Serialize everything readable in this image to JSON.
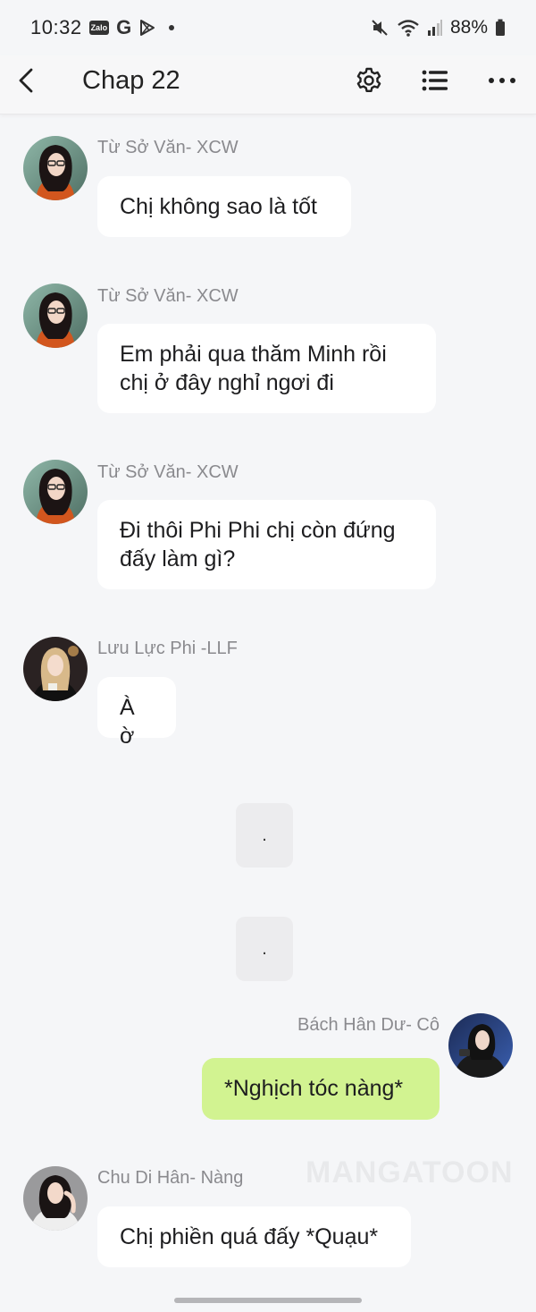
{
  "status_bar": {
    "time": "10:32",
    "notif_zalo": "Zalo",
    "notif_g": "G",
    "battery": "88%"
  },
  "app_bar": {
    "title": "Chap 22"
  },
  "messages": [
    {
      "sender": "Từ Sở Văn- XCW",
      "text": "Chị không sao là tốt",
      "side": "left"
    },
    {
      "sender": "Từ Sở Văn- XCW",
      "text_lines": [
        "Em phải qua thăm Minh rồi",
        "chị ở đây nghỉ ngơi đi"
      ],
      "side": "left"
    },
    {
      "sender": "Từ Sở Văn- XCW",
      "text_lines": [
        "Đi thôi Phi Phi chị còn đứng",
        "đấy làm gì?"
      ],
      "side": "left"
    },
    {
      "sender": "Lưu Lực Phi -LLF",
      "text": "À ờ",
      "side": "left"
    },
    {
      "text": ".",
      "side": "center"
    },
    {
      "text": ".",
      "side": "center"
    },
    {
      "sender": "Bách Hân Dư- Cô",
      "text": "*Nghịch tóc nàng*",
      "side": "right"
    },
    {
      "sender": "Chu Di Hân- Nàng",
      "text": "Chị phiền quá đấy *Quạu*",
      "side": "left"
    }
  ],
  "watermark": "MANGATOON",
  "colors": {
    "background": "#f5f6f8",
    "bubble_other": "#ffffff",
    "bubble_mine": "#d2f391",
    "sender_text": "#8a8a8e"
  },
  "icons": [
    "back-icon",
    "gear-icon",
    "list-icon",
    "more-icon",
    "mute-icon",
    "wifi-icon",
    "signal-icon",
    "battery-icon",
    "play-store-icon"
  ]
}
